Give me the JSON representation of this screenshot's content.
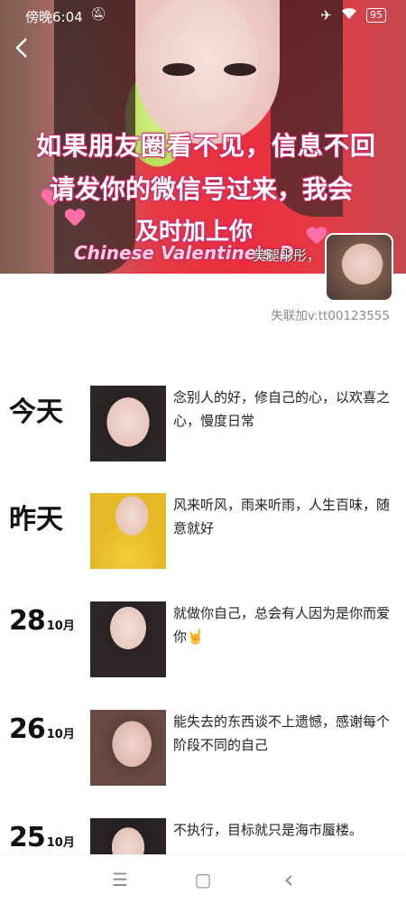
{
  "status_bar": {
    "time": "傍晚6:04",
    "mute_icon": "bell-off-icon",
    "battery": "95"
  },
  "cover": {
    "line1": "如果朋友圈看不见，信息不回",
    "line2": "请发你的微信号过来，我会",
    "line3": "及时加上你",
    "line4": "Chinese Valentine's D"
  },
  "profile": {
    "name": "美腿彤彤，",
    "signature": "失联加v:tt00123555"
  },
  "posts": [
    {
      "date": "今天",
      "day": "",
      "month": "",
      "text": "念别人的好，修自己的心，以欢喜之心，慢度日常"
    },
    {
      "date": "昨天",
      "day": "",
      "month": "",
      "text": "风来听风，雨来听雨，人生百味，随意就好"
    },
    {
      "date": "",
      "day": "28",
      "month": "10月",
      "text": "就做你自己，总会有人因为是你而爱你🤘"
    },
    {
      "date": "",
      "day": "26",
      "month": "10月",
      "text": "能失去的东西谈不上遗憾，感谢每个阶段不同的自己"
    },
    {
      "date": "",
      "day": "25",
      "month": "10月",
      "text": "不执行，目标就只是海市蜃楼。"
    }
  ],
  "nav": {
    "menu_glyph": "☰",
    "home_glyph": "▢",
    "back_glyph": "‹"
  },
  "colors": {
    "cover_red": "#e53b46",
    "signature_gray": "#8a8a8a",
    "text_dark": "#222222"
  }
}
